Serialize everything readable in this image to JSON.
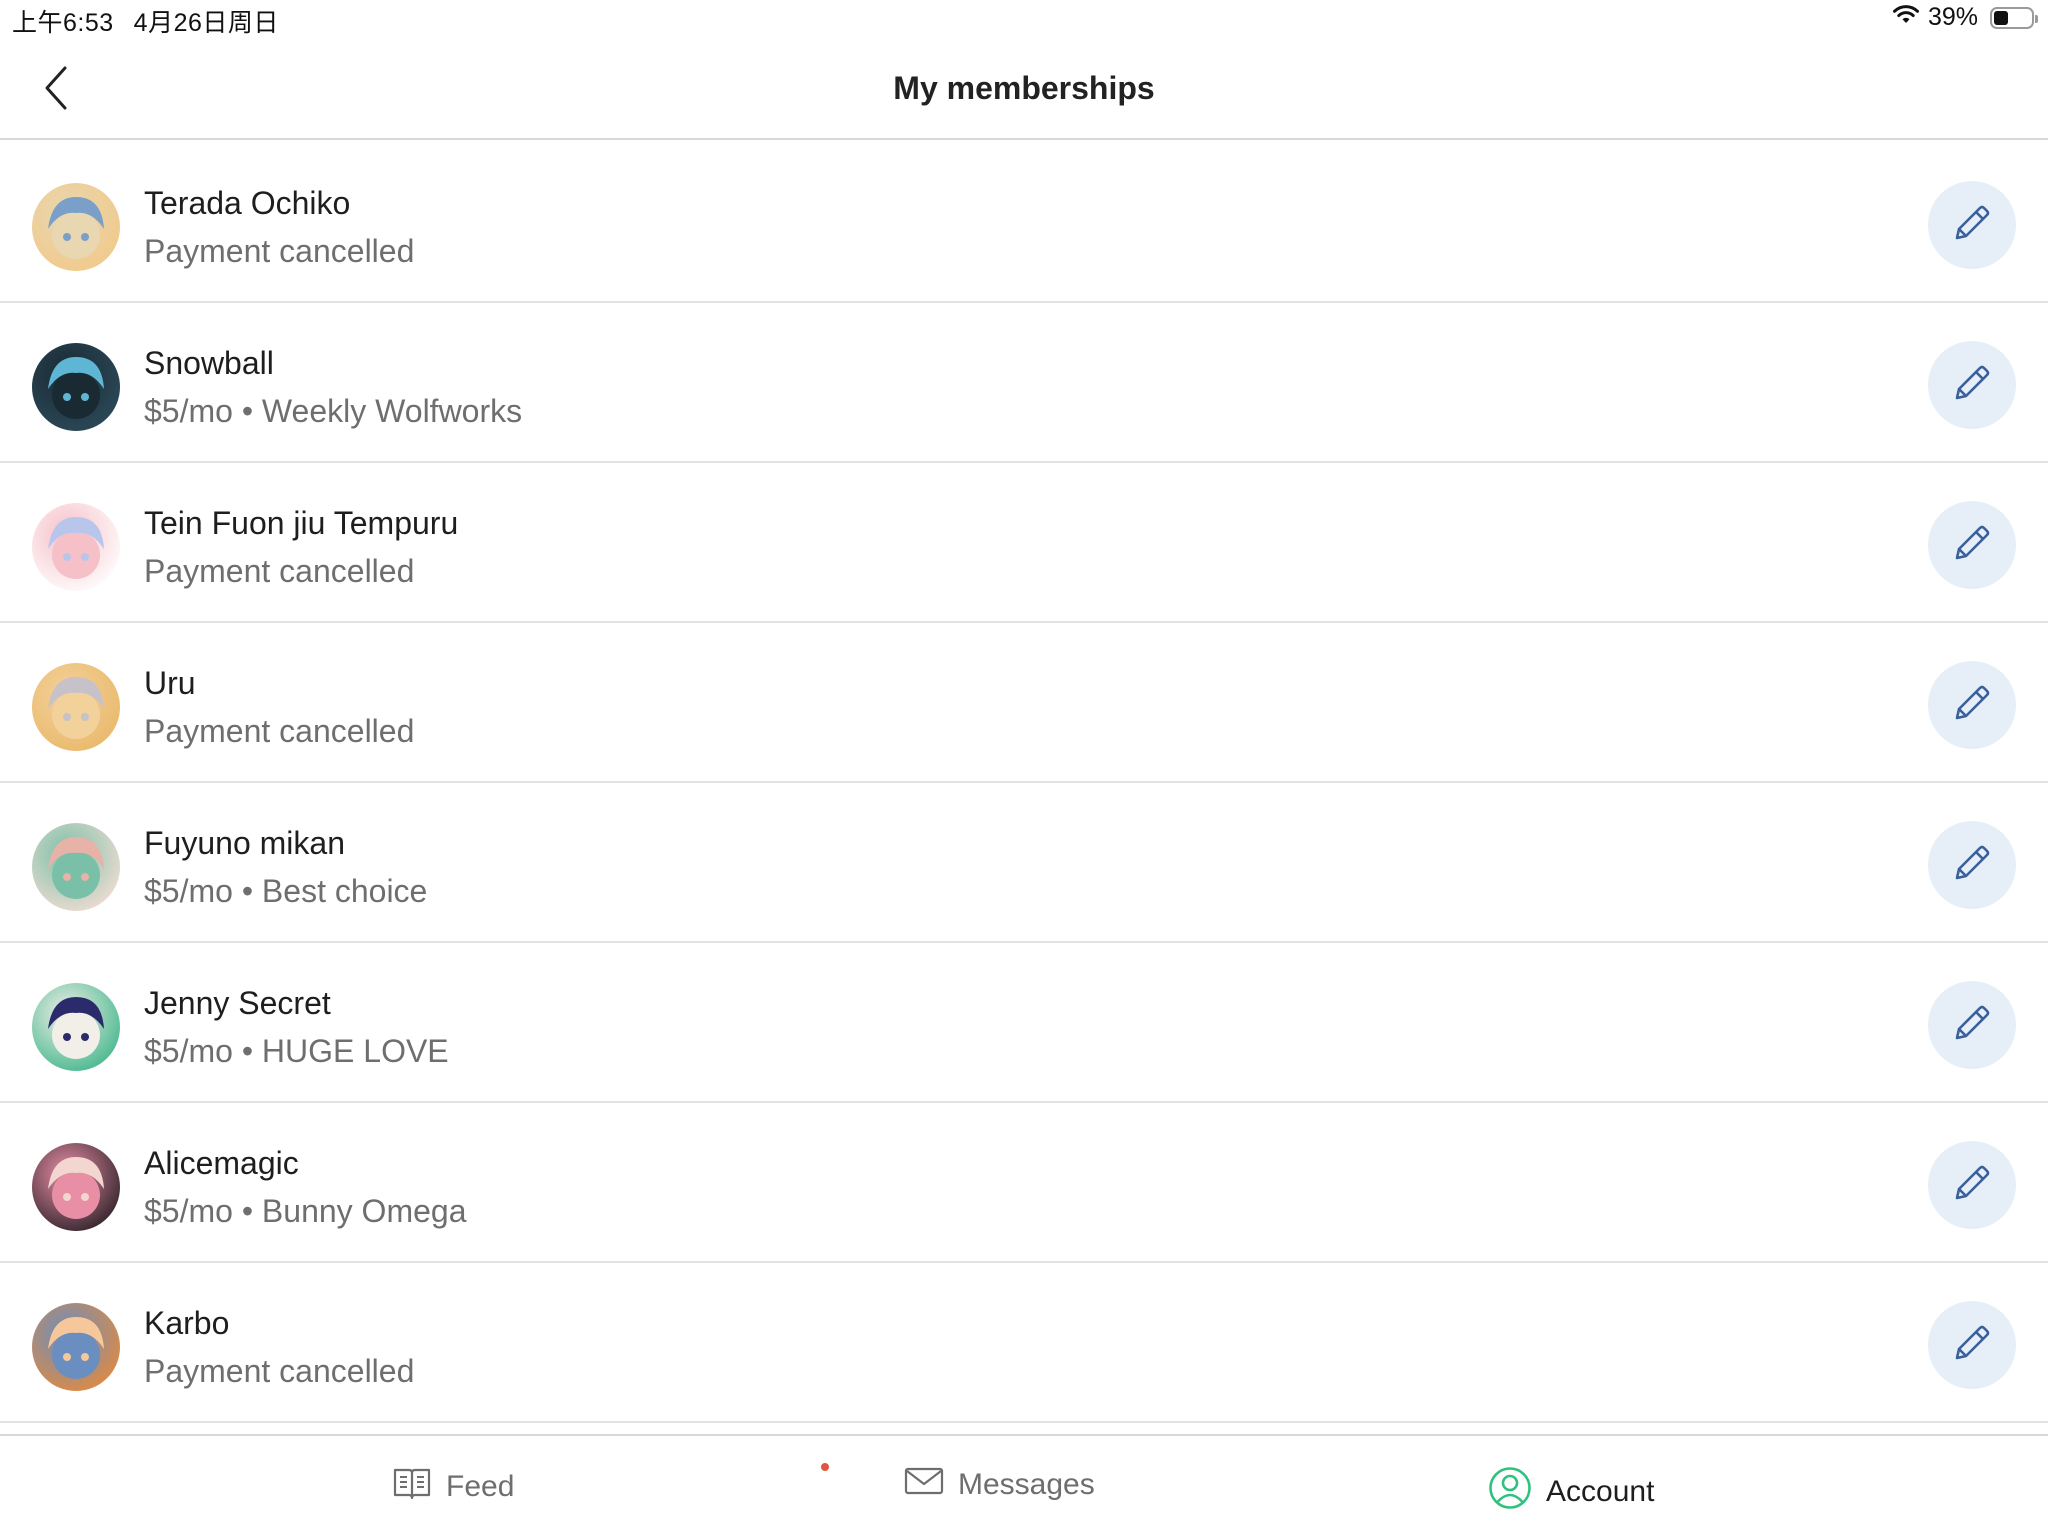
{
  "status_bar": {
    "time": "上午6:53",
    "date": "4月26日周日",
    "battery_percent": "39%",
    "battery_level": 0.39
  },
  "header": {
    "title": "My memberships",
    "back_icon": "chevron-left-icon"
  },
  "memberships": [
    {
      "name": "Terada Ochiko",
      "status": "Payment cancelled",
      "avatar_colors": [
        "#f2c98a",
        "#7aa0c9",
        "#e8d7b0"
      ]
    },
    {
      "name": "Snowball",
      "status": "$5/mo • Weekly Wolfworks",
      "avatar_colors": [
        "#2c4a5a",
        "#5fb6d4",
        "#1a2a33"
      ]
    },
    {
      "name": "Tein Fuon jiu Tempuru",
      "status": "Payment cancelled",
      "avatar_colors": [
        "#ffffff",
        "#b9c6ec",
        "#f5c0c8"
      ]
    },
    {
      "name": "Uru",
      "status": "Payment cancelled",
      "avatar_colors": [
        "#e9b86a",
        "#c7c2c9",
        "#f3d19a"
      ]
    },
    {
      "name": "Fuyuno mikan",
      "status": "$5/mo • Best choice",
      "avatar_colors": [
        "#f4ddd4",
        "#e7b2a7",
        "#7ac0a8"
      ]
    },
    {
      "name": "Jenny Secret",
      "status": "$5/mo • HUGE LOVE",
      "avatar_colors": [
        "#3fb58a",
        "#2b2a6b",
        "#f1efe8"
      ]
    },
    {
      "name": "Alicemagic",
      "status": "$5/mo • Bunny Omega",
      "avatar_colors": [
        "#2a1f26",
        "#f3d6cf",
        "#e88fa6"
      ]
    },
    {
      "name": "Karbo",
      "status": "Payment cancelled",
      "avatar_colors": [
        "#e58a3c",
        "#f5c79a",
        "#6a8ec0"
      ]
    }
  ],
  "edit_icon": "pencil-icon",
  "tabs": [
    {
      "label": "Feed",
      "icon": "book-icon",
      "selected": false
    },
    {
      "label": "Messages",
      "icon": "envelope-icon",
      "selected": false,
      "unread_dot_color": "#e0553d"
    },
    {
      "label": "Account",
      "icon": "user-circle-icon",
      "selected": true,
      "accent": "#2ec27e"
    }
  ],
  "colors": {
    "edit_button_bg": "#e6eef7",
    "edit_icon_stroke": "#3a5f9a",
    "secondary_text": "#6e6e6e",
    "divider": "#e3e3e3"
  }
}
